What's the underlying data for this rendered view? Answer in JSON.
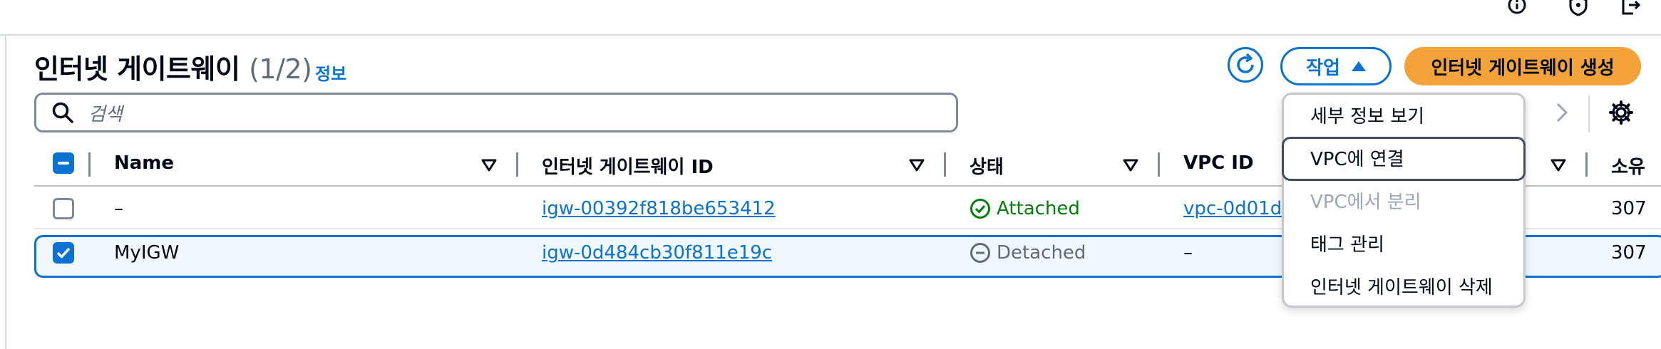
{
  "top_icons": [
    "info-icon",
    "shield-icon",
    "external-icon"
  ],
  "header": {
    "title": "인터넷 게이트웨이",
    "count": "(1/2)",
    "info": "정보",
    "actions_label": "작업",
    "create_label": "인터넷 게이트웨이 생성"
  },
  "search": {
    "placeholder": "검색"
  },
  "table": {
    "columns": [
      "Name",
      "인터넷 게이트웨이 ID",
      "상태",
      "VPC ID",
      "소유"
    ],
    "rows": [
      {
        "name": "–",
        "id": "igw-00392f818be653412",
        "status": "Attached",
        "vpc": "vpc-0d01d",
        "owner": "307",
        "selected": false
      },
      {
        "name": "MyIGW",
        "id": "igw-0d484cb30f811e19c",
        "status": "Detached",
        "vpc": "–",
        "owner": "307",
        "selected": true
      }
    ]
  },
  "actions_menu": {
    "items": [
      {
        "label": "세부 정보 보기",
        "disabled": false
      },
      {
        "label": "VPC에 연결",
        "disabled": false,
        "highlighted": true
      },
      {
        "label": "VPC에서 분리",
        "disabled": true
      },
      {
        "label": "태그 관리",
        "disabled": false
      },
      {
        "label": "인터넷 게이트웨이 삭제",
        "disabled": false
      }
    ]
  },
  "colors": {
    "accent": "#0972d3",
    "primary_button": "#f3a33a",
    "success": "#037f0c",
    "disabled": "#9ba7b6"
  }
}
